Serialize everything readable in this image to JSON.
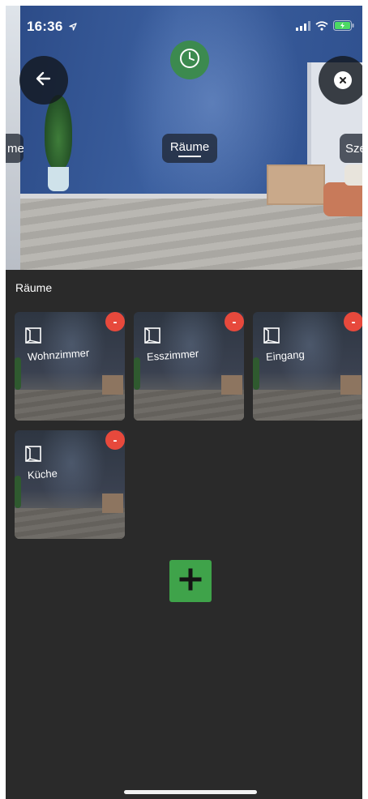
{
  "status_bar": {
    "time": "16:36",
    "location_icon": "location-arrow-icon",
    "signal_icon": "cellular-signal-icon",
    "wifi_icon": "wifi-icon",
    "battery_icon": "battery-charging-icon"
  },
  "hero": {
    "tabs": {
      "left_partial": "me",
      "center": "Räume",
      "right_partial": "Sze"
    },
    "back_icon": "arrow-left-icon",
    "close_icon": "close-circle-icon",
    "clock_icon": "clock-icon"
  },
  "section_title": "Räume",
  "rooms": [
    {
      "name": "Wohnzimmer",
      "remove_label": "-"
    },
    {
      "name": "Esszimmer",
      "remove_label": "-"
    },
    {
      "name": "Eingang",
      "remove_label": "-"
    },
    {
      "name": "Küche",
      "remove_label": "-"
    }
  ],
  "add_button_icon": "plus-icon",
  "colors": {
    "background": "#2a2a2a",
    "remove": "#e7493c",
    "add": "#3fa34a",
    "clock": "#3c8a4f"
  }
}
